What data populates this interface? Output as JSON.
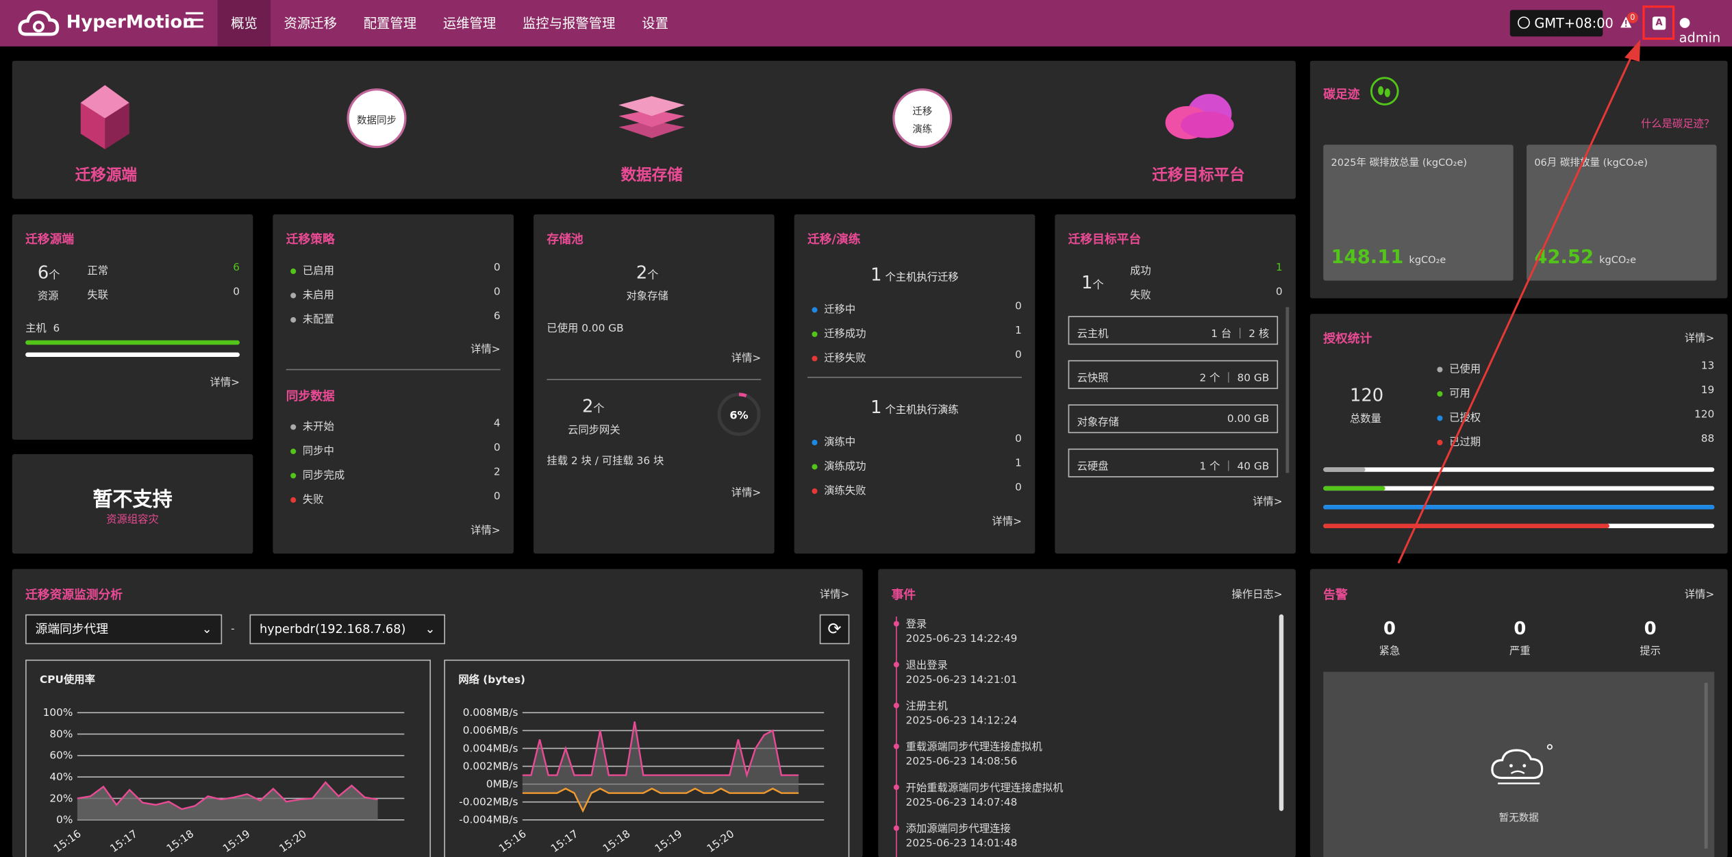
{
  "app": {
    "brand": "HyperMotion"
  },
  "nav": [
    {
      "label": "概览",
      "active": true
    },
    {
      "label": "资源迁移"
    },
    {
      "label": "配置管理"
    },
    {
      "label": "运维管理"
    },
    {
      "label": "监控与报警管理"
    },
    {
      "label": "设置"
    }
  ],
  "header": {
    "timezone": "GMT+08:00",
    "alert_count": "0",
    "ai_label": "A",
    "user": "admin"
  },
  "flow": {
    "source": "迁移源端",
    "step1": "数据同步",
    "storage": "数据存储",
    "step2_line1": "迁移",
    "step2_line2": "演练",
    "target": "迁移目标平台"
  },
  "source_card": {
    "title": "迁移源端",
    "count": "6",
    "unit": "个",
    "count_label": "资源",
    "normal_label": "正常",
    "normal": "6",
    "lost_label": "失联",
    "lost": "0",
    "host_label": "主机",
    "host_count": "6",
    "detail": "详情>"
  },
  "unsupported": {
    "title": "暂不支持",
    "sub": "资源组容灾"
  },
  "strategy": {
    "title": "迁移策略",
    "items": [
      {
        "label": "已启用",
        "value": "0",
        "color": "#52c41a"
      },
      {
        "label": "未启用",
        "value": "0",
        "color": "#aaaaaa"
      },
      {
        "label": "未配置",
        "value": "6",
        "color": "#aaaaaa"
      }
    ],
    "detail": "详情>"
  },
  "sync": {
    "title": "同步数据",
    "items": [
      {
        "label": "未开始",
        "value": "4",
        "color": "#aaaaaa"
      },
      {
        "label": "同步中",
        "value": "0",
        "color": "#52c41a"
      },
      {
        "label": "同步完成",
        "value": "2",
        "color": "#52c41a"
      },
      {
        "label": "失败",
        "value": "0",
        "color": "#e53935"
      }
    ],
    "detail": "详情>"
  },
  "storage_pool": {
    "title": "存储池",
    "count": "2",
    "unit": "个",
    "type": "对象存储",
    "used": "已使用 0.00 GB",
    "detail1": "详情>",
    "gw_count": "2",
    "gw_unit": "个",
    "gw_label": "云同步网关",
    "percent": "6%",
    "percent_value": 0.06,
    "mount": "挂载 2 块 / 可挂载 36 块",
    "detail2": "详情>"
  },
  "migrate": {
    "title": "迁移/演练",
    "m_count": "1",
    "m_label": "个主机执行迁移",
    "m_items": [
      {
        "label": "迁移中",
        "value": "0",
        "color": "#1e88e5"
      },
      {
        "label": "迁移成功",
        "value": "1",
        "color": "#52c41a"
      },
      {
        "label": "迁移失败",
        "value": "0",
        "color": "#e53935"
      }
    ],
    "d_count": "1",
    "d_label": "个主机执行演练",
    "d_items": [
      {
        "label": "演练中",
        "value": "0",
        "color": "#1e88e5"
      },
      {
        "label": "演练成功",
        "value": "1",
        "color": "#52c41a"
      },
      {
        "label": "演练失败",
        "value": "0",
        "color": "#e53935"
      }
    ],
    "detail": "详情>"
  },
  "target": {
    "title": "迁移目标平台",
    "count": "1",
    "unit": "个",
    "ok_label": "成功",
    "ok": "1",
    "fail_label": "失败",
    "fail": "0",
    "boxes": [
      {
        "label": "云主机",
        "value": "1 台 ｜ 2 核"
      },
      {
        "label": "云快照",
        "value": "2 个 ｜ 80 GB"
      },
      {
        "label": "对象存储",
        "value": "0.00 GB"
      },
      {
        "label": "云硬盘",
        "value": "1 个 ｜ 40 GB"
      }
    ],
    "detail": "详情>"
  },
  "carbon": {
    "title": "碳足迹",
    "link": "什么是碳足迹？",
    "year_label": "2025年 碳排放总量 (kgCO₂e)",
    "year_value": "148.11",
    "month_label": "06月 碳排放量 (kgCO₂e)",
    "month_value": "42.52",
    "unit": "kgCO₂e"
  },
  "license": {
    "title": "授权统计",
    "detail": "详情>",
    "total": "120",
    "total_label": "总数量",
    "items": [
      {
        "label": "已使用",
        "value": "13",
        "color": "#aaaaaa",
        "ratio": 0.108
      },
      {
        "label": "可用",
        "value": "19",
        "color": "#52c41a",
        "ratio": 0.158
      },
      {
        "label": "已授权",
        "value": "120",
        "color": "#1e88e5",
        "ratio": 1.0
      },
      {
        "label": "已过期",
        "value": "88",
        "color": "#e53935",
        "ratio": 0.733
      }
    ]
  },
  "monitor": {
    "title": "迁移资源监测分析",
    "detail": "详情>",
    "select1": "源端同步代理",
    "dash": "-",
    "select2": "hyperbdr(192.168.7.68)"
  },
  "chart_data": [
    {
      "type": "area",
      "title": "CPU使用率",
      "x": [
        "15:16",
        "15:17",
        "15:18",
        "15:19",
        "15:20"
      ],
      "yticks": [
        "100%",
        "80%",
        "60%",
        "40%",
        "20%",
        "0%"
      ],
      "ylim": [
        0,
        100
      ],
      "values": [
        20,
        22,
        31,
        14,
        28,
        16,
        14,
        17,
        10,
        13,
        22,
        19,
        21,
        24,
        18,
        29,
        17,
        19,
        20,
        35,
        22,
        32,
        21,
        19
      ]
    },
    {
      "type": "line",
      "title": "网络 (bytes)",
      "x": [
        "15:16",
        "15:17",
        "15:18",
        "15:19",
        "15:20"
      ],
      "yticks": [
        "0.008MB/s",
        "0.006MB/s",
        "0.004MB/s",
        "0.002MB/s",
        "0MB/s",
        "-0.002MB/s",
        "-0.004MB/s"
      ],
      "ylim": [
        -0.004,
        0.008
      ],
      "series": [
        {
          "values": [
            0.001,
            0.001,
            0.005,
            0.001,
            0.001,
            0.004,
            0.001,
            0.001,
            0.001,
            0.006,
            0.001,
            0.001,
            0.001,
            0.007,
            0.001,
            0.001,
            0.001,
            0.001,
            0.001,
            0.001,
            0.001,
            0.001,
            0.001,
            0.001,
            0.001,
            0.005,
            0.001,
            0.004,
            0.0055,
            0.006,
            0.001,
            0.001,
            0.001
          ]
        },
        {
          "values": [
            -0.001,
            -0.001,
            -0.001,
            -0.001,
            -0.001,
            -0.0005,
            -0.001,
            -0.003,
            -0.001,
            -0.0005,
            -0.001,
            -0.001,
            -0.001,
            -0.001,
            -0.001,
            -0.0005,
            -0.001,
            -0.001,
            -0.001,
            -0.001,
            -0.0005,
            -0.001,
            -0.001,
            -0.0005,
            -0.001,
            -0.001,
            -0.001,
            -0.001,
            -0.001,
            -0.0005,
            -0.001,
            -0.001,
            -0.001
          ]
        }
      ]
    }
  ],
  "events": {
    "title": "事件",
    "link": "操作日志>",
    "items": [
      {
        "name": "登录",
        "time": "2025-06-23 14:22:49"
      },
      {
        "name": "退出登录",
        "time": "2025-06-23 14:21:01"
      },
      {
        "name": "注册主机",
        "time": "2025-06-23 14:12:24"
      },
      {
        "name": "重载源端同步代理连接虚拟机",
        "time": "2025-06-23 14:08:56"
      },
      {
        "name": "开始重载源端同步代理连接虚拟机",
        "time": "2025-06-23 14:07:48"
      },
      {
        "name": "添加源端同步代理连接",
        "time": "2025-06-23 14:01:48"
      }
    ]
  },
  "alarm": {
    "title": "告警",
    "detail": "详情>",
    "items": [
      {
        "value": "0",
        "label": "紧急"
      },
      {
        "value": "0",
        "label": "严重"
      },
      {
        "value": "0",
        "label": "提示"
      }
    ],
    "empty": "暂无数据"
  }
}
